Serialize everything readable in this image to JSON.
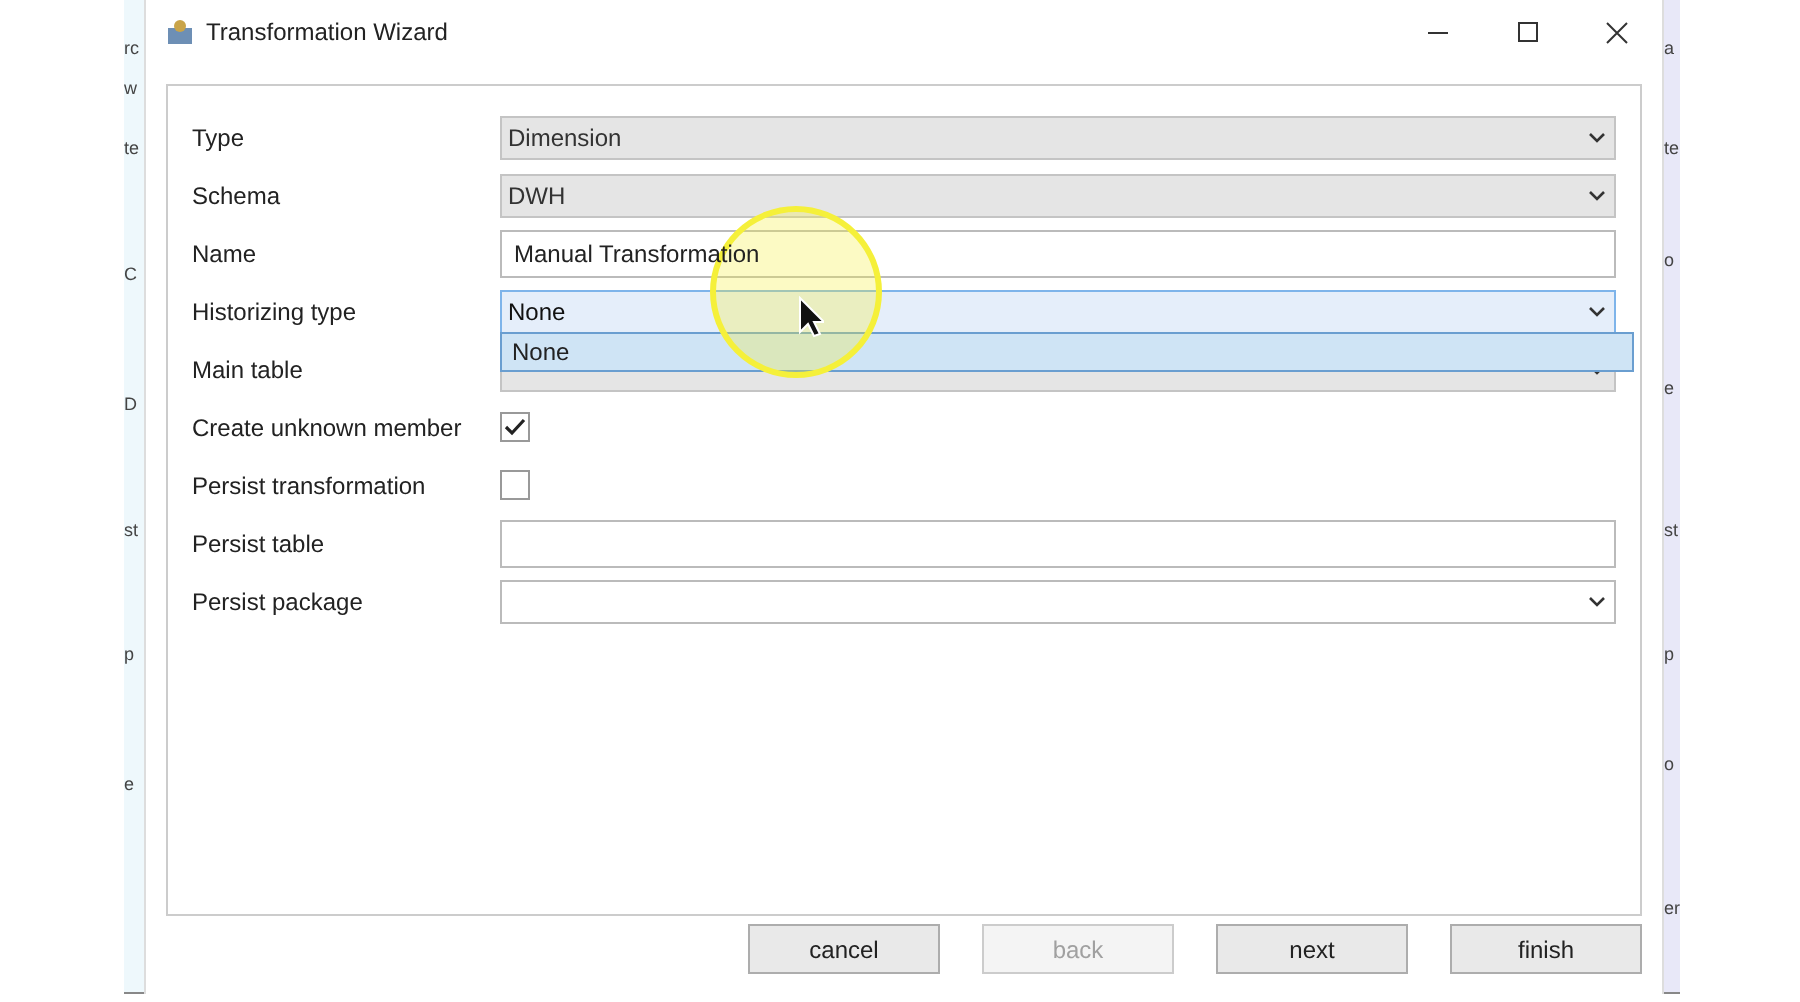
{
  "window": {
    "title": "Transformation Wizard"
  },
  "background_left": [
    "rc",
    "w",
    "te",
    "C",
    "D",
    "st",
    "p",
    "e"
  ],
  "background_right": [
    "a",
    "te",
    "o",
    "e",
    "st",
    "p",
    "o",
    "er"
  ],
  "fields": [
    {
      "label": "Type",
      "kind": "select",
      "value": "Dimension",
      "disabled": true
    },
    {
      "label": "Schema",
      "kind": "select",
      "value": "DWH",
      "disabled": true
    },
    {
      "label": "Name",
      "kind": "text",
      "value": "Manual Transformation"
    },
    {
      "label": "Historizing type",
      "kind": "select",
      "value": "None",
      "disabled": false,
      "expanded": true,
      "options": [
        {
          "label": "None",
          "selected": true
        }
      ]
    },
    {
      "label": "Main table",
      "kind": "select",
      "disabled": true
    },
    {
      "label": "Create unknown member",
      "kind": "checkbox",
      "checked": true
    },
    {
      "label": "Persist transformation",
      "kind": "checkbox",
      "checked": false
    },
    {
      "label": "Persist table",
      "kind": "text"
    },
    {
      "label": "Persist package",
      "kind": "select",
      "disabled": false
    }
  ],
  "buttons": [
    {
      "label": "cancel",
      "disabled": false
    },
    {
      "label": "back",
      "disabled": true
    },
    {
      "label": "next",
      "disabled": false
    },
    {
      "label": "finish",
      "disabled": false
    }
  ]
}
